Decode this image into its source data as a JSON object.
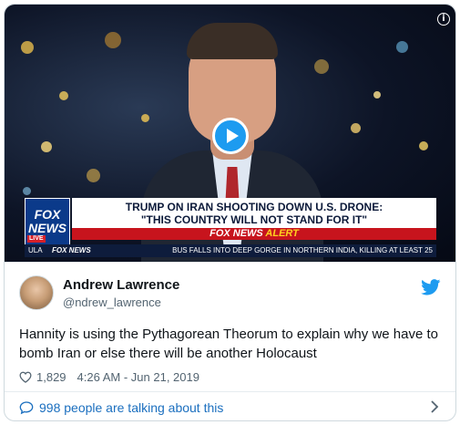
{
  "video": {
    "headline_line1": "TRUMP ON IRAN SHOOTING DOWN U.S. DRONE:",
    "headline_line2": "\"THIS COUNTRY WILL NOT STAND FOR IT\"",
    "logo_top": "FOX",
    "logo_bottom": "NEWS",
    "logo_live": "LIVE",
    "alert_brand": "FOX NEWS",
    "alert_word": "ALERT",
    "ticker_left": "ULA",
    "ticker_brand": "FOX NEWS",
    "ticker_news": "BUS FALLS INTO DEEP GORGE IN NORTHERN INDIA, KILLING AT LEAST 25",
    "info_symbol": "i"
  },
  "tweet": {
    "name": "Andrew Lawrence",
    "handle": "@ndrew_lawrence",
    "text": "Hannity is using the Pythagorean Theorum to explain why we have to bomb Iran or else there will be another Holocaust",
    "likes": "1,829",
    "timestamp": "4:26 AM - Jun 21, 2019"
  },
  "footer": {
    "talking": "998 people are talking about this"
  },
  "colors": {
    "twitter_blue": "#1d9bf0",
    "fox_red": "#c7141d",
    "fox_navy": "#0b3a8a"
  }
}
